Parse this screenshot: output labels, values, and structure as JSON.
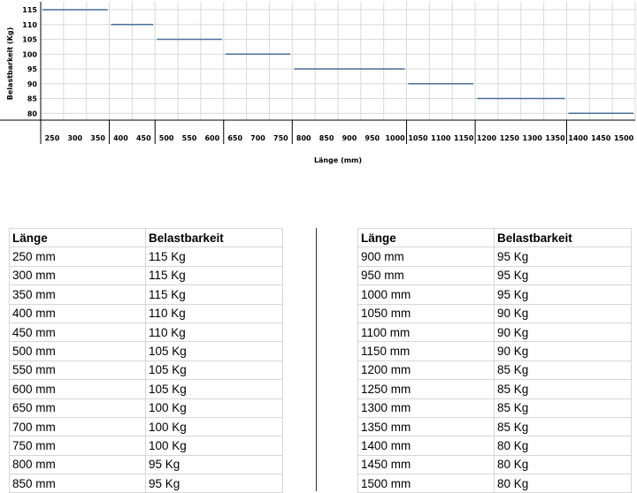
{
  "chart_data": {
    "type": "line",
    "title": "",
    "xlabel": "Länge (mm)",
    "ylabel": "Belastbarkeit (Kg)",
    "ylim": [
      75,
      115
    ],
    "yticks": [
      80,
      85,
      90,
      95,
      100,
      105,
      110,
      115
    ],
    "grid": true,
    "categories": [
      "250",
      "300",
      "350",
      "400",
      "450",
      "500",
      "550",
      "600",
      "650",
      "700",
      "750",
      "800",
      "850",
      "900",
      "950",
      "1000",
      "1050",
      "1100",
      "1150",
      "1200",
      "1250",
      "1300",
      "1350",
      "1400",
      "1450",
      "1500"
    ],
    "values": [
      115,
      115,
      115,
      110,
      110,
      105,
      105,
      105,
      100,
      100,
      100,
      95,
      95,
      95,
      95,
      95,
      90,
      90,
      90,
      85,
      85,
      85,
      85,
      80,
      80,
      80
    ],
    "line_color": "#4a6f99"
  },
  "table": {
    "header": [
      "Länge",
      "Belastbarkeit"
    ],
    "rows_left": [
      [
        "250 mm",
        "115 Kg"
      ],
      [
        "300 mm",
        "115 Kg"
      ],
      [
        "350 mm",
        "115 Kg"
      ],
      [
        "400 mm",
        "110 Kg"
      ],
      [
        "450 mm",
        "110 Kg"
      ],
      [
        "500 mm",
        "105 Kg"
      ],
      [
        "550 mm",
        "105 Kg"
      ],
      [
        "600 mm",
        "105 Kg"
      ],
      [
        "650 mm",
        "100 Kg"
      ],
      [
        "700 mm",
        "100 Kg"
      ],
      [
        "750 mm",
        "100 Kg"
      ],
      [
        "800 mm",
        "95 Kg"
      ],
      [
        "850 mm",
        "95 Kg"
      ]
    ],
    "rows_right": [
      [
        "900 mm",
        "95 Kg"
      ],
      [
        "950 mm",
        "95 Kg"
      ],
      [
        "1000 mm",
        "95 Kg"
      ],
      [
        "1050 mm",
        "90 Kg"
      ],
      [
        "1100 mm",
        "90 Kg"
      ],
      [
        "1150 mm",
        "90 Kg"
      ],
      [
        "1200 mm",
        "85 Kg"
      ],
      [
        "1250 mm",
        "85 Kg"
      ],
      [
        "1300 mm",
        "85 Kg"
      ],
      [
        "1350 mm",
        "85 Kg"
      ],
      [
        "1400 mm",
        "80 Kg"
      ],
      [
        "1450 mm",
        "80 Kg"
      ],
      [
        "1500 mm",
        "80 Kg"
      ]
    ]
  }
}
